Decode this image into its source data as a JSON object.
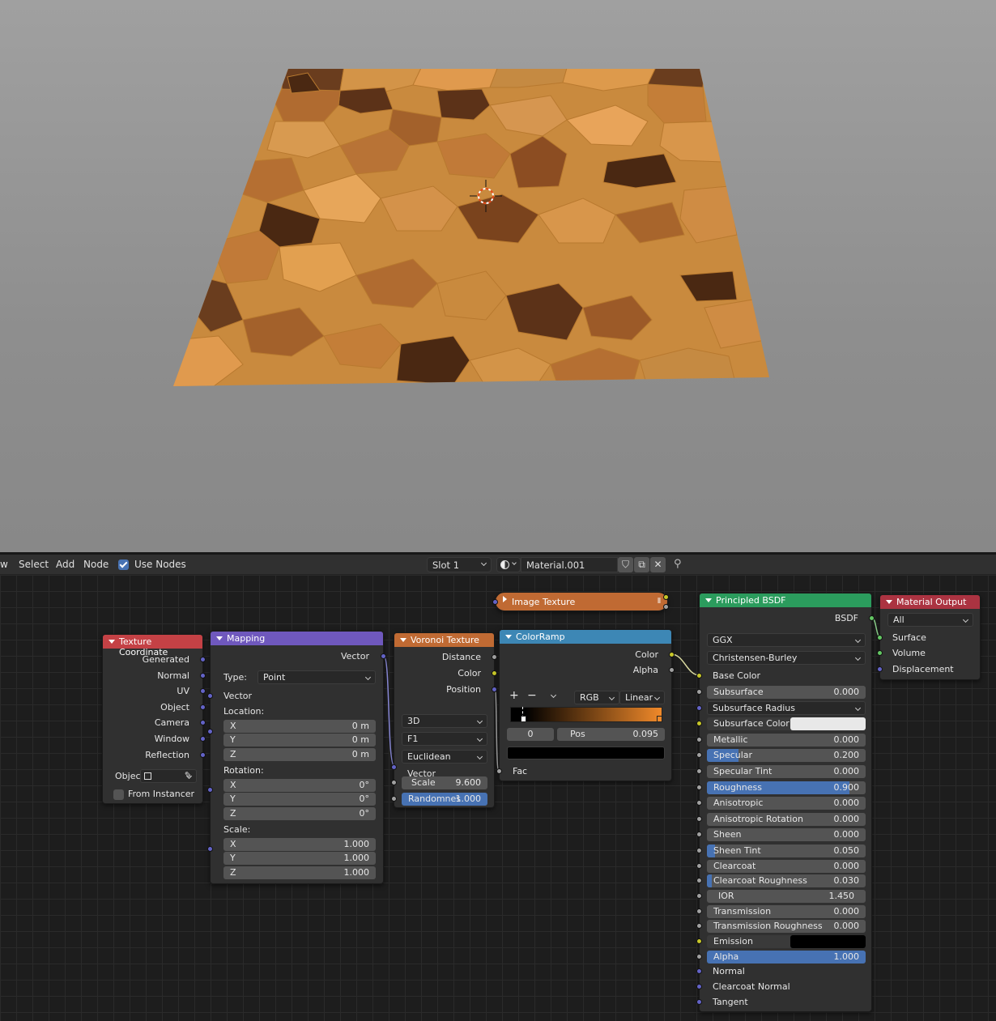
{
  "header": {
    "menu_view": "w",
    "menu_select": "Select",
    "menu_add": "Add",
    "menu_node": "Node",
    "use_nodes_label": "Use Nodes",
    "use_nodes_checked": true,
    "slot": "Slot 1",
    "material_name": "Material.001"
  },
  "nodes": {
    "texcoord": {
      "title": "Texture Coordinate",
      "outputs": [
        "Generated",
        "Normal",
        "UV",
        "Object",
        "Camera",
        "Window",
        "Reflection"
      ],
      "object_label": "Objec",
      "from_instancer_label": "From Instancer",
      "from_instancer_checked": false
    },
    "mapping": {
      "title": "Mapping",
      "output": "Vector",
      "type_label": "Type:",
      "type_value": "Point",
      "input_vector": "Vector",
      "location_label": "Location:",
      "location": [
        {
          "axis": "X",
          "value": "0 m"
        },
        {
          "axis": "Y",
          "value": "0 m"
        },
        {
          "axis": "Z",
          "value": "0 m"
        }
      ],
      "rotation_label": "Rotation:",
      "rotation": [
        {
          "axis": "X",
          "value": "0°"
        },
        {
          "axis": "Y",
          "value": "0°"
        },
        {
          "axis": "Z",
          "value": "0°"
        }
      ],
      "scale_label": "Scale:",
      "scale": [
        {
          "axis": "X",
          "value": "1.000"
        },
        {
          "axis": "Y",
          "value": "1.000"
        },
        {
          "axis": "Z",
          "value": "1.000"
        }
      ]
    },
    "voronoi": {
      "title": "Voronoi Texture",
      "outputs": [
        "Distance",
        "Color",
        "Position"
      ],
      "dimensions": "3D",
      "feature": "F1",
      "distance_metric": "Euclidean",
      "input_vector": "Vector",
      "scale_label": "Scale",
      "scale_value": "9.600",
      "randomness_label": "Randomnes",
      "randomness_value": "1.000"
    },
    "colorramp": {
      "title": "ColorRamp",
      "outputs": [
        "Color",
        "Alpha"
      ],
      "add": "+",
      "remove": "−",
      "color_mode": "RGB",
      "interpolation": "Linear",
      "stop_index": "0",
      "pos_label": "Pos",
      "pos_value": "0.095",
      "input_fac": "Fac",
      "gradient_start": "#000000",
      "gradient_end": "#f0892a"
    },
    "imagetexture": {
      "title": "Image Texture"
    },
    "bsdf": {
      "title": "Principled BSDF",
      "output": "BSDF",
      "distribution": "GGX",
      "subsurface_method": "Christensen-Burley",
      "base_color_label": "Base Color",
      "subsurface": {
        "label": "Subsurface",
        "value": "0.000"
      },
      "subsurface_radius_label": "Subsurface Radius",
      "subsurface_color_label": "Subsurface Color",
      "subsurface_color": "#e8e8e8",
      "metallic": {
        "label": "Metallic",
        "value": "0.000"
      },
      "specular": {
        "label": "Specular",
        "value": "0.200",
        "fill": 0.2
      },
      "specular_tint": {
        "label": "Specular Tint",
        "value": "0.000"
      },
      "roughness": {
        "label": "Roughness",
        "value": "0.900",
        "fill": 0.9
      },
      "anisotropic": {
        "label": "Anisotropic",
        "value": "0.000"
      },
      "anisotropic_rotation": {
        "label": "Anisotropic Rotation",
        "value": "0.000"
      },
      "sheen": {
        "label": "Sheen",
        "value": "0.000"
      },
      "sheen_tint": {
        "label": "Sheen Tint",
        "value": "0.050",
        "fill": 0.05
      },
      "clearcoat": {
        "label": "Clearcoat",
        "value": "0.000"
      },
      "clearcoat_roughness": {
        "label": "Clearcoat Roughness",
        "value": "0.030",
        "fill": 0.03
      },
      "ior": {
        "label": "IOR",
        "value": "1.450"
      },
      "transmission": {
        "label": "Transmission",
        "value": "0.000"
      },
      "transmission_roughness": {
        "label": "Transmission Roughness",
        "value": "0.000"
      },
      "emission_label": "Emission",
      "emission_color": "#000000",
      "alpha": {
        "label": "Alpha",
        "value": "1.000",
        "fill": 1.0
      },
      "normal_label": "Normal",
      "clearcoat_normal_label": "Clearcoat Normal",
      "tangent_label": "Tangent"
    },
    "output": {
      "title": "Material Output",
      "target": "All",
      "inputs": [
        "Surface",
        "Volume",
        "Displacement"
      ]
    }
  },
  "colors": {
    "texture_header": "#c44145",
    "vector_header": "#6f58bd",
    "voronoi_header": "#c06a33",
    "converter_header": "#3d87b5",
    "shader_header": "#2b9c5d",
    "output_header": "#ab3341",
    "accent": "#4772b3"
  }
}
